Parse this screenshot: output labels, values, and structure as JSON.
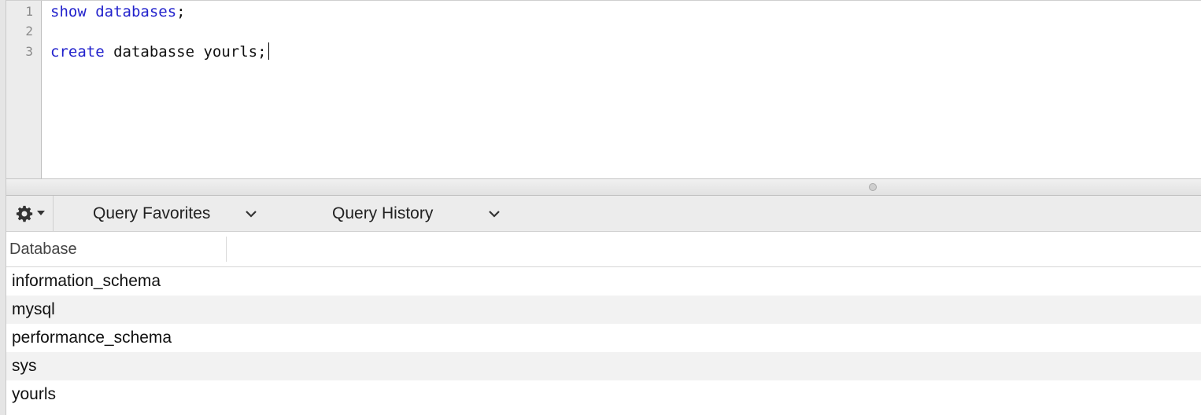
{
  "editor": {
    "line_numbers": [
      "1",
      "2",
      "3"
    ],
    "line1": {
      "kw1": "show",
      "kw2": "databases",
      "rest": ";"
    },
    "line3": {
      "kw1": "create",
      "rest": " databasse yourls;"
    }
  },
  "toolbar": {
    "gear_icon": "gear-icon",
    "favorites_label": "Query Favorites",
    "history_label": "Query History"
  },
  "results": {
    "columns": [
      "Database"
    ],
    "rows": [
      "information_schema",
      "mysql",
      "performance_schema",
      "sys",
      "yourls"
    ]
  }
}
